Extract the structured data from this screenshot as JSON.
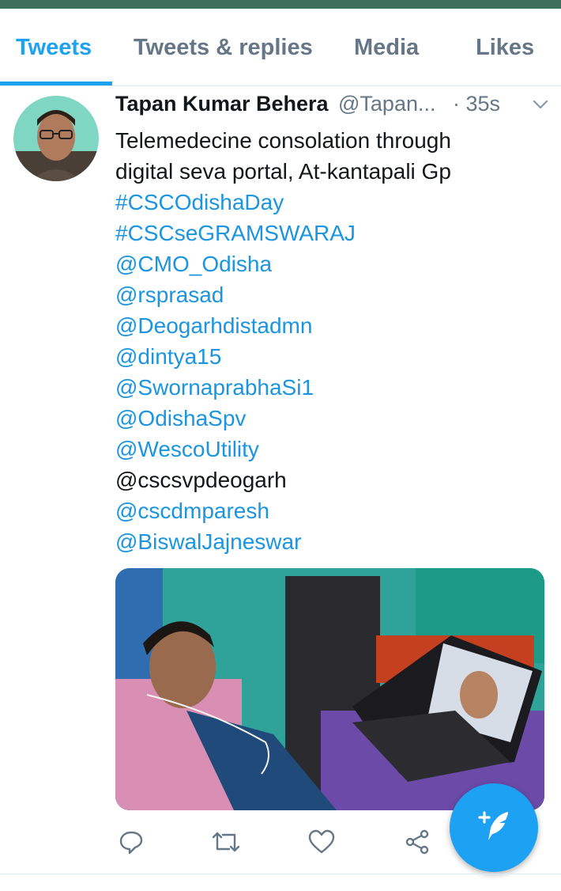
{
  "tabs": {
    "items": [
      {
        "label": "Tweets",
        "active": true
      },
      {
        "label": "Tweets & replies",
        "active": false
      },
      {
        "label": "Media",
        "active": false
      },
      {
        "label": "Likes",
        "active": false
      }
    ]
  },
  "tweet": {
    "author_name": "Tapan Kumar Behera",
    "handle": "@Tapan...",
    "time": "· 35s",
    "text_lines": [
      "Telemedecine consolation through",
      "digital seva portal, At-kantapali Gp"
    ],
    "hashtags": [
      "#CSCOdishaDay",
      "#CSCseGRAMSWARAJ"
    ],
    "mentions": [
      "@CMO_Odisha",
      "@rsprasad",
      "@Deogarhdistadmn",
      "@dintya15",
      "@SwornaprabhaSi1",
      "@OdishaSpv",
      "@WescoUtility",
      "@cscsvpdeogarh",
      "@cscdmparesh",
      "@BiswalJajneswar"
    ],
    "unlinked_mention": "@cscsvpdeogarh"
  },
  "actions": [
    "reply-icon",
    "retweet-icon",
    "like-icon",
    "share-icon"
  ],
  "fab": {
    "icon": "compose-tweet-icon"
  },
  "colors": {
    "accent": "#1da1f2",
    "link": "#1b95e0",
    "secondary_text": "#657786",
    "primary_text": "#14171a",
    "top_bar": "#3f6f5b"
  }
}
